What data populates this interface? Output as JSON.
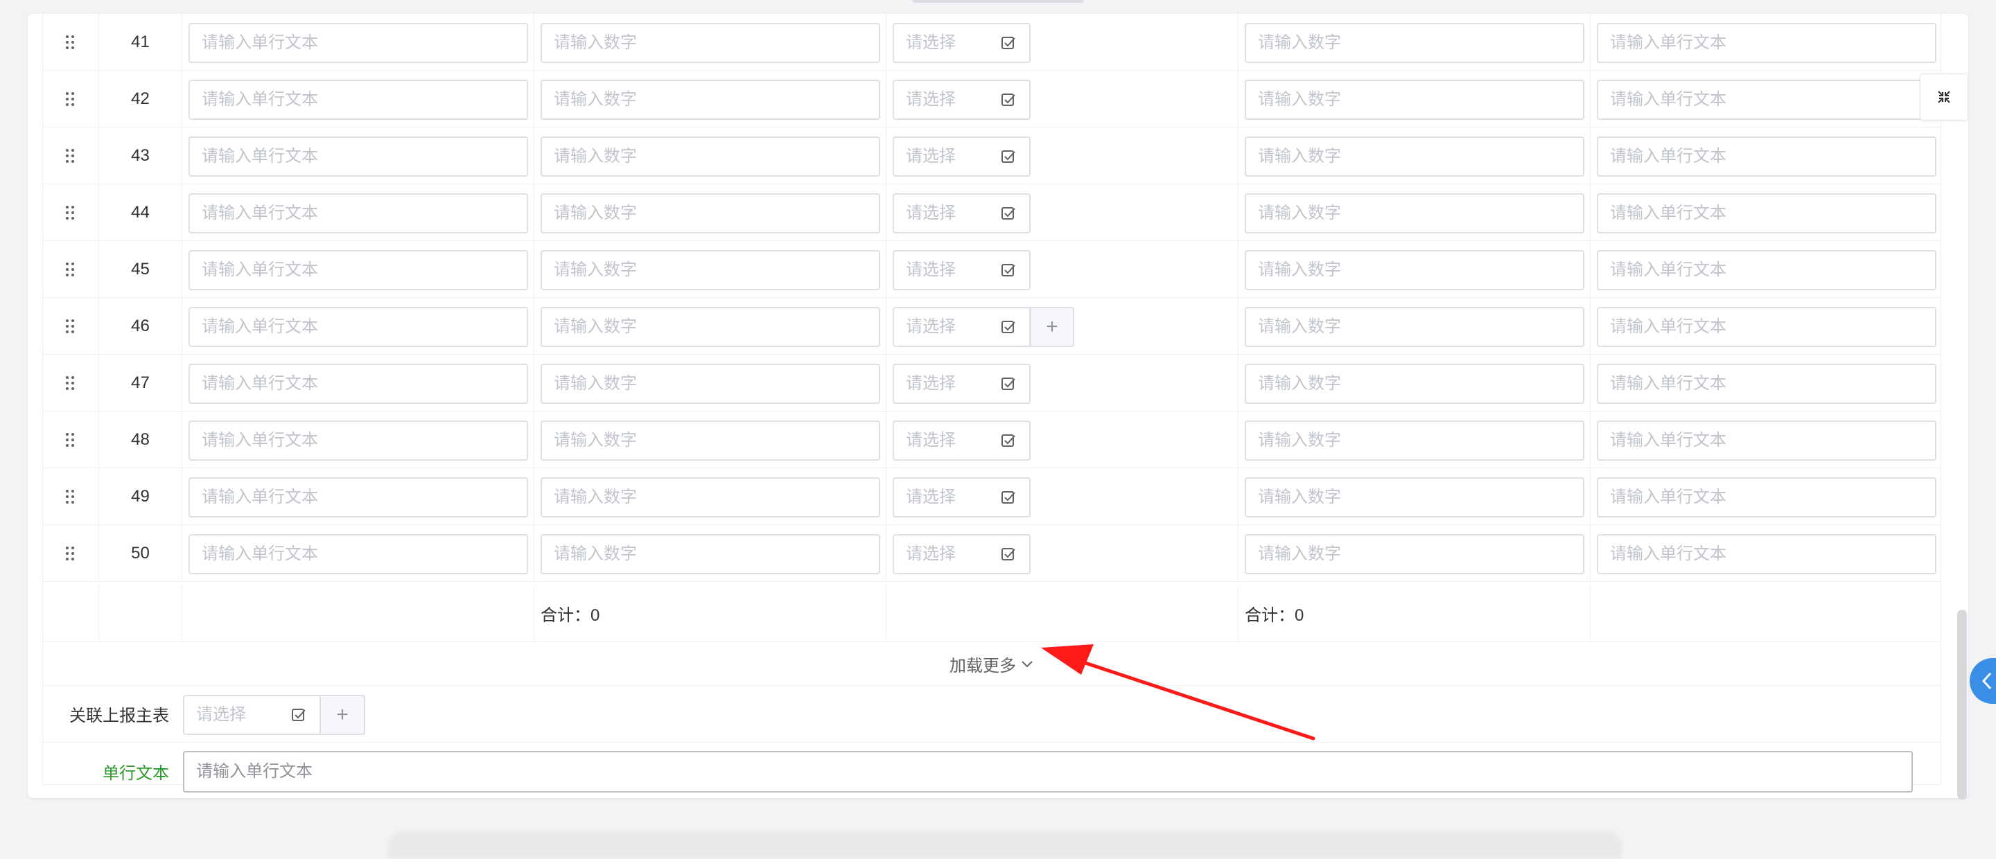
{
  "table": {
    "rows": [
      {
        "num": "41",
        "has_plus": false
      },
      {
        "num": "42",
        "has_plus": false
      },
      {
        "num": "43",
        "has_plus": false
      },
      {
        "num": "44",
        "has_plus": false
      },
      {
        "num": "45",
        "has_plus": false
      },
      {
        "num": "46",
        "has_plus": true
      },
      {
        "num": "47",
        "has_plus": false
      },
      {
        "num": "48",
        "has_plus": false
      },
      {
        "num": "49",
        "has_plus": false
      },
      {
        "num": "50",
        "has_plus": false
      }
    ],
    "placeholders": {
      "text": "请输入单行文本",
      "number": "请输入数字",
      "select": "请选择"
    },
    "plus_label": "+",
    "summary": {
      "col2": "合计：0",
      "col4": "合计：0"
    },
    "load_more": "加载更多"
  },
  "form": {
    "related_label": "关联上报主表",
    "related_placeholder": "请选择",
    "related_plus": "+",
    "text_label": "单行文本",
    "text_placeholder": "请输入单行文本"
  },
  "icons": {
    "drag": "drag-handle-icon",
    "select": "select-check-icon",
    "chevron": "chevron-down-icon",
    "fullscreen": "fullscreen-exit-icon",
    "side": "chevron-left-icon"
  },
  "colors": {
    "label_green": "#2b9a2b",
    "accent_blue": "#3a8ee6",
    "annotation_red": "#ff1a1a"
  }
}
